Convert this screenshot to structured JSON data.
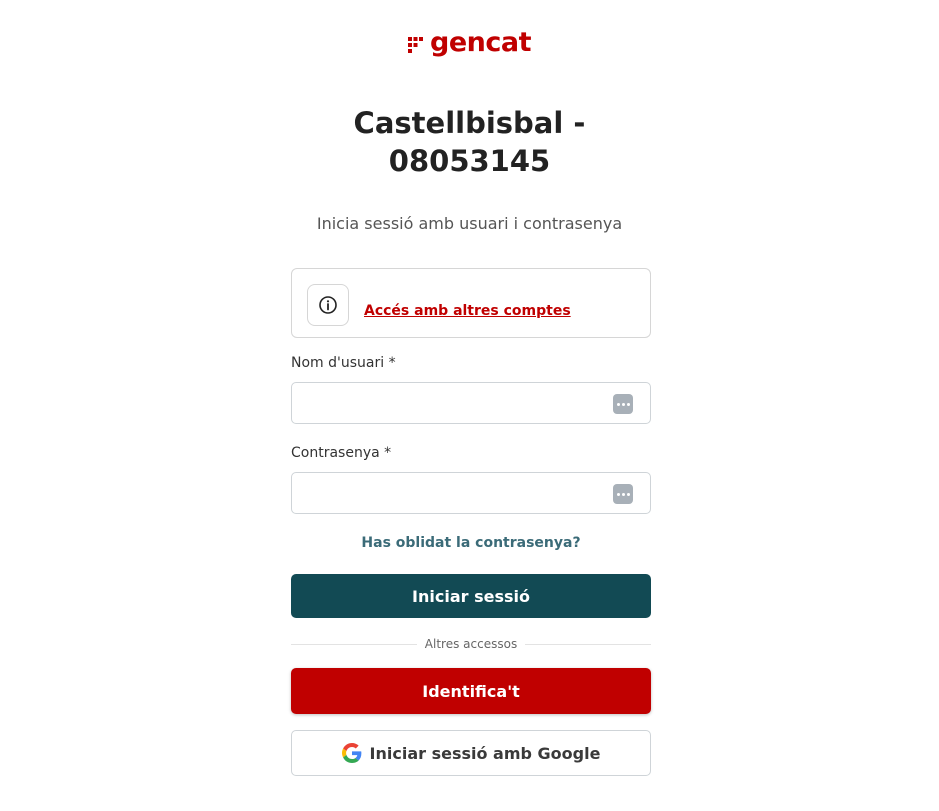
{
  "brand": {
    "logo_text": "gencat",
    "color": "#c00000"
  },
  "header": {
    "title_line1": "Castellbisbal -",
    "title_line2": "08053145",
    "subtitle": "Inicia sessió amb usuari i contrasenya"
  },
  "info_box": {
    "icon": "info-circle-icon",
    "link_text": "Accés amb altres comptes"
  },
  "form": {
    "username": {
      "label": "Nom d'usuari *",
      "value": "",
      "placeholder": ""
    },
    "password": {
      "label": "Contrasenya *",
      "value": "",
      "placeholder": ""
    },
    "password_manager_icon": "password-manager-icon"
  },
  "links": {
    "forgot_password": "Has oblidat la contrasenya?"
  },
  "buttons": {
    "login": "Iniciar sessió",
    "identify": "Identifica't",
    "google": "Iniciar sessió amb Google"
  },
  "divider": {
    "text": "Altres accessos"
  },
  "colors": {
    "primary": "#124a54",
    "brand_red": "#c00000",
    "link_teal": "#3b6b78"
  }
}
